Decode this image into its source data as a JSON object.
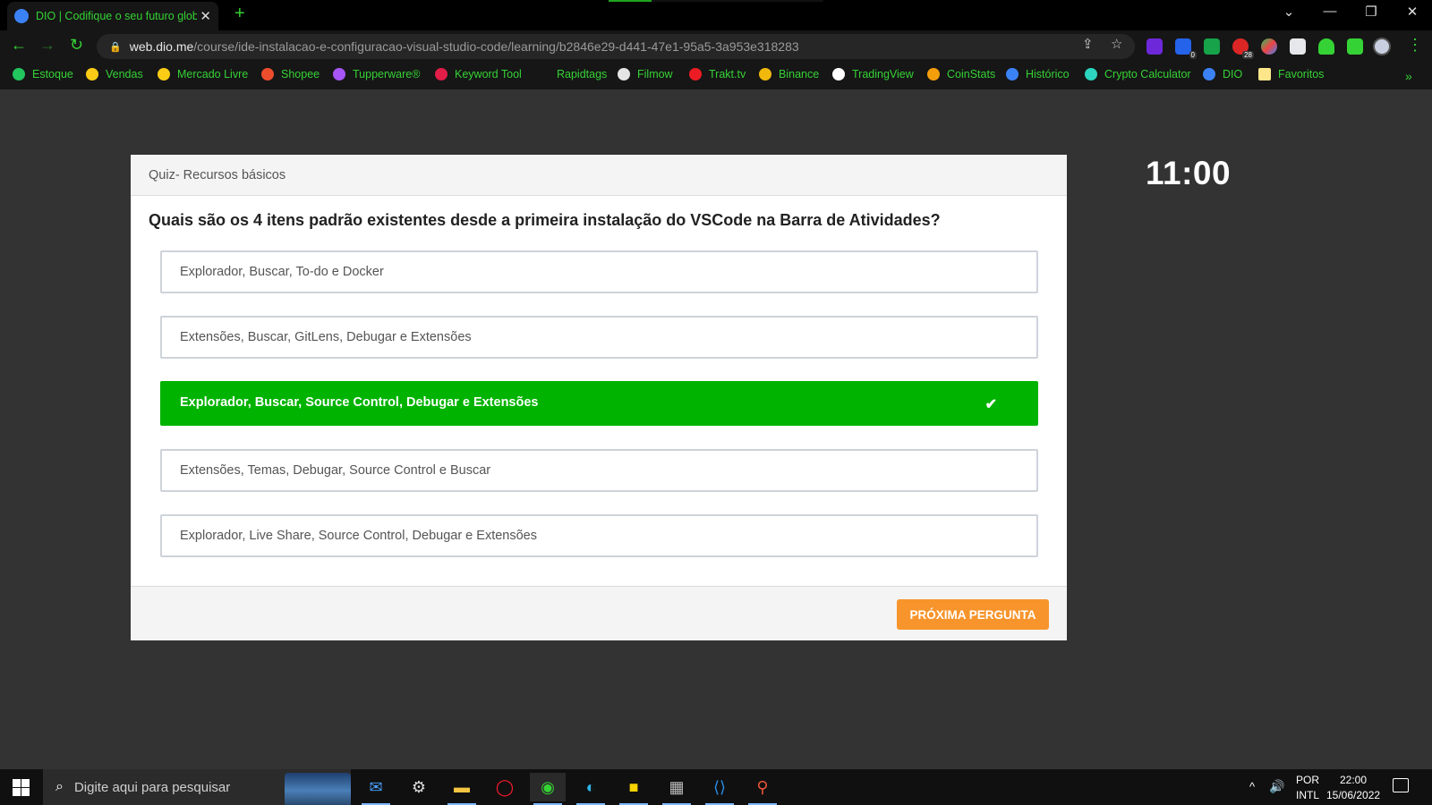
{
  "browser": {
    "tab_title": "DIO | Codifique o seu futuro glob",
    "url_host": "web.dio.me",
    "url_path": "/course/ide-instalacao-e-configuracao-visual-studio-code/learning/b2846e29-d441-47e1-95a5-3a953e318283",
    "extension_badges": {
      "second": "0",
      "fourth": "28"
    }
  },
  "bookmarks": [
    {
      "label": "Estoque",
      "color": "#22c55e"
    },
    {
      "label": "Vendas",
      "color": "#facc15"
    },
    {
      "label": "Mercado Livre",
      "color": "#facc15"
    },
    {
      "label": "Shopee",
      "color": "#ee4d2d"
    },
    {
      "label": "Tupperware®",
      "color": "#a855f7"
    },
    {
      "label": "Keyword Tool",
      "color": "#e11d48"
    },
    {
      "label": "Rapidtags",
      "color": "#161616"
    },
    {
      "label": "Filmow",
      "color": "#e5e5e5"
    },
    {
      "label": "Trakt.tv",
      "color": "#ed1c24"
    },
    {
      "label": "Binance",
      "color": "#f0b90b"
    },
    {
      "label": "TradingView",
      "color": "#ffffff"
    },
    {
      "label": "CoinStats",
      "color": "#f59e0b"
    },
    {
      "label": "Histórico",
      "color": "#3b82f6"
    },
    {
      "label": "Crypto Calculator",
      "color": "#2dd4bf"
    },
    {
      "label": "DIO",
      "color": "#3b82f6"
    },
    {
      "label": "Favoritos",
      "color": "#fde68a"
    }
  ],
  "quiz": {
    "header": "Quiz- Recursos básicos",
    "question": "Quais são os 4 itens padrão existentes desde a primeira instalação do VSCode na Barra de Atividades?",
    "options": [
      "Explorador, Buscar, To-do e Docker",
      "Extensões, Buscar, GitLens, Debugar e Extensões",
      "Explorador, Buscar, Source Control, Debugar e Extensões",
      "Extensões, Temas, Debugar, Source Control e Buscar",
      "Explorador, Live Share, Source Control, Debugar e Extensões"
    ],
    "selected_index": 2,
    "next_label": "PRÓXIMA PERGUNTA",
    "correct_color": "#00b300",
    "next_color": "#f7952c"
  },
  "timer": "11:00",
  "taskbar": {
    "search_placeholder": "Digite aqui para pesquisar",
    "lang_top": "POR",
    "lang_bottom": "INTL",
    "time": "22:00",
    "date": "15/06/2022"
  }
}
